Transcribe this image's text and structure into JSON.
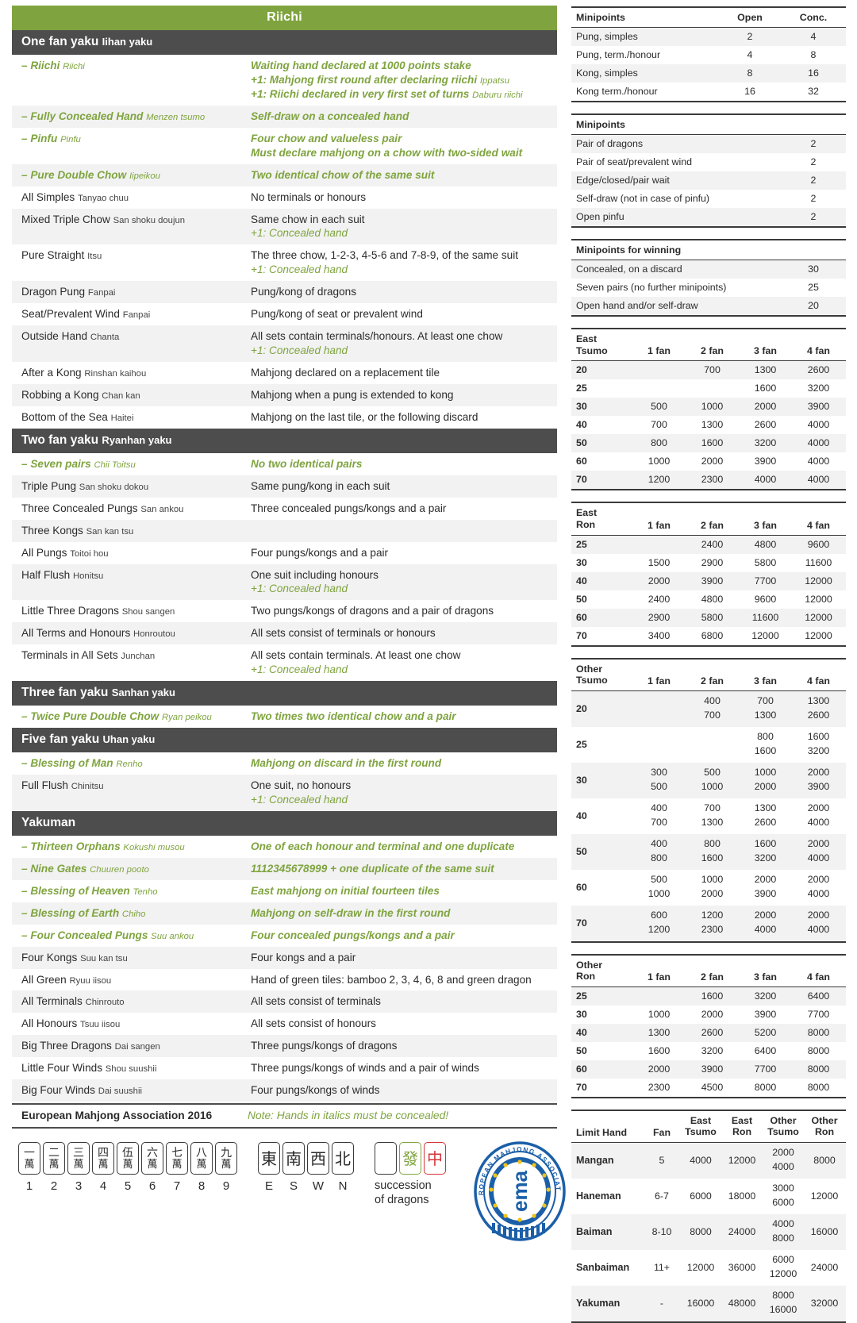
{
  "title": "Riichi",
  "sections": [
    {
      "heading": "One fan yaku",
      "heading_rom": "Iihan yaku",
      "rows": [
        {
          "name": "– Riichi",
          "rom": "Riichi",
          "green": true,
          "desc": [
            "Waiting hand declared at 1000 points stake"
          ],
          "extras": [
            {
              "text": "+1: Mahjong first round after declaring riichi ",
              "rom": "Ippatsu"
            },
            {
              "text": "+1: Riichi declared in very first set of turns ",
              "rom": "Daburu riichi"
            }
          ]
        },
        {
          "name": "– Fully Concealed Hand",
          "rom": "Menzen tsumo",
          "green": true,
          "desc": [
            "Self-draw on a concealed hand"
          ]
        },
        {
          "name": "– Pinfu",
          "rom": "Pinfu",
          "green": true,
          "desc": [
            "Four chow and valueless pair",
            "Must declare mahjong on a chow with two-sided wait"
          ]
        },
        {
          "name": "– Pure Double Chow",
          "rom": "Iipeikou",
          "green": true,
          "desc": [
            "Two identical chow of the same suit"
          ]
        },
        {
          "name": "All Simples",
          "rom": "Tanyao chuu",
          "green": false,
          "desc": [
            "No terminals or honours"
          ]
        },
        {
          "name": "Mixed Triple Chow",
          "rom": "San shoku doujun",
          "green": false,
          "desc": [
            "Same chow in each suit"
          ],
          "plus": "+1: Concealed hand"
        },
        {
          "name": "Pure Straight",
          "rom": "Itsu",
          "green": false,
          "desc": [
            "The three chow, 1-2-3, 4-5-6 and 7-8-9, of the same suit"
          ],
          "plus": "+1: Concealed hand"
        },
        {
          "name": "Dragon Pung",
          "rom": "Fanpai",
          "green": false,
          "desc": [
            "Pung/kong of dragons"
          ]
        },
        {
          "name": "Seat/Prevalent Wind",
          "rom": "Fanpai",
          "green": false,
          "desc": [
            "Pung/kong of seat or prevalent wind"
          ]
        },
        {
          "name": "Outside Hand",
          "rom": "Chanta",
          "green": false,
          "desc": [
            "All sets contain terminals/honours. At least one chow"
          ],
          "plus": "+1: Concealed hand"
        },
        {
          "name": "After a Kong",
          "rom": "Rinshan kaihou",
          "green": false,
          "desc": [
            "Mahjong declared on a replacement tile"
          ]
        },
        {
          "name": "Robbing a Kong",
          "rom": "Chan kan",
          "green": false,
          "desc": [
            "Mahjong when a pung is extended to kong"
          ]
        },
        {
          "name": "Bottom of the Sea",
          "rom": "Haitei",
          "green": false,
          "desc": [
            "Mahjong on the last tile, or the following discard"
          ]
        }
      ]
    },
    {
      "heading": "Two fan yaku",
      "heading_rom": "Ryanhan yaku",
      "rows": [
        {
          "name": "– Seven pairs",
          "rom": "Chii Toitsu",
          "green": true,
          "desc": [
            "No two identical pairs"
          ]
        },
        {
          "name": "Triple Pung",
          "rom": "San shoku dokou",
          "green": false,
          "desc": [
            "Same pung/kong in each suit"
          ]
        },
        {
          "name": "Three Concealed Pungs",
          "rom": "San ankou",
          "green": false,
          "desc": [
            "Three concealed pungs/kongs and a pair"
          ]
        },
        {
          "name": "Three Kongs",
          "rom": "San kan tsu",
          "green": false,
          "desc": [
            ""
          ]
        },
        {
          "name": "All Pungs",
          "rom": "Toitoi hou",
          "green": false,
          "desc": [
            "Four pungs/kongs and a pair"
          ]
        },
        {
          "name": "Half Flush",
          "rom": "Honitsu",
          "green": false,
          "desc": [
            "One suit including honours"
          ],
          "plus": "+1: Concealed hand"
        },
        {
          "name": "Little Three Dragons",
          "rom": "Shou sangen",
          "green": false,
          "desc": [
            "Two pungs/kongs of dragons and a pair of dragons"
          ]
        },
        {
          "name": "All Terms and Honours",
          "rom": "Honroutou",
          "green": false,
          "desc": [
            "All sets consist of terminals or honours"
          ]
        },
        {
          "name": "Terminals in All Sets",
          "rom": "Junchan",
          "green": false,
          "desc": [
            "All sets contain terminals. At least one chow"
          ],
          "plus": "+1: Concealed hand"
        }
      ]
    },
    {
      "heading": "Three fan yaku",
      "heading_rom": "Sanhan yaku",
      "rows": [
        {
          "name": "– Twice Pure Double Chow",
          "rom": "Ryan peikou",
          "green": true,
          "desc": [
            "Two times two identical chow and a pair"
          ]
        }
      ]
    },
    {
      "heading": "Five fan yaku",
      "heading_rom": "Uhan yaku",
      "rows": [
        {
          "name": "– Blessing of Man",
          "rom": "Renho",
          "green": true,
          "desc": [
            "Mahjong on discard in the first round"
          ]
        },
        {
          "name": "Full Flush",
          "rom": "Chinitsu",
          "green": false,
          "desc": [
            "One suit, no honours"
          ],
          "plus": "+1: Concealed hand"
        }
      ]
    },
    {
      "heading": "Yakuman",
      "heading_rom": "",
      "rows": [
        {
          "name": "– Thirteen Orphans",
          "rom": "Kokushi musou",
          "green": true,
          "desc": [
            "One of each honour and terminal and one duplicate"
          ]
        },
        {
          "name": "– Nine Gates",
          "rom": "Chuuren pooto",
          "green": true,
          "desc": [
            "1112345678999 + one duplicate of the same suit"
          ]
        },
        {
          "name": "– Blessing of Heaven",
          "rom": "Tenho",
          "green": true,
          "desc": [
            "East mahjong on initial fourteen tiles"
          ]
        },
        {
          "name": "– Blessing of Earth",
          "rom": "Chiho",
          "green": true,
          "desc": [
            "Mahjong on self-draw in the first round"
          ]
        },
        {
          "name": "– Four Concealed Pungs",
          "rom": "Suu ankou",
          "green": true,
          "desc": [
            "Four concealed pungs/kongs and a pair"
          ]
        },
        {
          "name": "Four Kongs",
          "rom": "Suu kan tsu",
          "green": false,
          "desc": [
            "Four kongs and a pair"
          ]
        },
        {
          "name": "All Green",
          "rom": "Ryuu iisou",
          "green": false,
          "desc": [
            "Hand of green tiles: bamboo 2, 3, 4, 6, 8 and green dragon"
          ]
        },
        {
          "name": "All Terminals",
          "rom": "Chinrouto",
          "green": false,
          "desc": [
            "All sets consist of terminals"
          ]
        },
        {
          "name": "All Honours",
          "rom": "Tsuu iisou",
          "green": false,
          "desc": [
            "All sets consist of honours"
          ]
        },
        {
          "name": "Big Three Dragons",
          "rom": "Dai sangen",
          "green": false,
          "desc": [
            "Three pungs/kongs of dragons"
          ]
        },
        {
          "name": "Little Four Winds",
          "rom": "Shou suushii",
          "green": false,
          "desc": [
            "Three pungs/kongs of winds and a pair of winds"
          ]
        },
        {
          "name": "Big Four Winds",
          "rom": "Dai suushii",
          "green": false,
          "desc": [
            "Four pungs/kongs of winds"
          ]
        }
      ]
    }
  ],
  "footer": {
    "ema": "European Mahjong Association 2016",
    "note": "Note: Hands in italics must be concealed!"
  },
  "tiles": {
    "characters": [
      {
        "top": "一",
        "bottom": "萬",
        "label": "1"
      },
      {
        "top": "二",
        "bottom": "萬",
        "label": "2"
      },
      {
        "top": "三",
        "bottom": "萬",
        "label": "3"
      },
      {
        "top": "四",
        "bottom": "萬",
        "label": "4"
      },
      {
        "top": "伍",
        "bottom": "萬",
        "label": "5"
      },
      {
        "top": "六",
        "bottom": "萬",
        "label": "6"
      },
      {
        "top": "七",
        "bottom": "萬",
        "label": "7"
      },
      {
        "top": "八",
        "bottom": "萬",
        "label": "8"
      },
      {
        "top": "九",
        "bottom": "萬",
        "label": "9"
      }
    ],
    "winds": [
      {
        "glyph": "東",
        "label": "E"
      },
      {
        "glyph": "南",
        "label": "S"
      },
      {
        "glyph": "西",
        "label": "W"
      },
      {
        "glyph": "北",
        "label": "N"
      }
    ],
    "dragons": [
      {
        "glyph": "",
        "color": "white"
      },
      {
        "glyph": "發",
        "color": "green"
      },
      {
        "glyph": "中",
        "color": "red"
      }
    ],
    "dragons_label_line1": "succession",
    "dragons_label_line2": "of dragons"
  },
  "logo": {
    "arc_top": "EUROPEAN MAHJONG ASSOCIATION",
    "center": "ema"
  },
  "colors": {
    "green": "#7fa43f",
    "dark": "#4d4d4d",
    "alt_row": "#f2f2f2",
    "red": "#d4343a"
  },
  "tables": {
    "minipoints_sets": {
      "title": "Minipoints",
      "columns": [
        "Open",
        "Conc."
      ],
      "rows": [
        {
          "label": "Pung, simples",
          "values": [
            "2",
            "4"
          ]
        },
        {
          "label": "Pung, term./honour",
          "values": [
            "4",
            "8"
          ]
        },
        {
          "label": "Kong, simples",
          "values": [
            "8",
            "16"
          ]
        },
        {
          "label": "Kong term./honour",
          "values": [
            "16",
            "32"
          ]
        }
      ]
    },
    "minipoints_misc": {
      "title": "Minipoints",
      "rows": [
        {
          "label": "Pair of dragons",
          "value": "2"
        },
        {
          "label": "Pair of seat/prevalent wind",
          "value": "2"
        },
        {
          "label": "Edge/closed/pair wait",
          "value": "2"
        },
        {
          "label": "Self-draw (not in case of pinfu)",
          "value": "2"
        },
        {
          "label": "Open pinfu",
          "value": "2"
        }
      ]
    },
    "minipoints_winning": {
      "title": "Minipoints for winning",
      "rows": [
        {
          "label": "Concealed, on a discard",
          "value": "30"
        },
        {
          "label": "Seven pairs (no further minipoints)",
          "value": "25"
        },
        {
          "label": "Open hand and/or self-draw",
          "value": "20"
        }
      ]
    },
    "east_tsumo": {
      "title_line1": "East",
      "title_line2": "Tsumo",
      "columns": [
        "1 fan",
        "2 fan",
        "3 fan",
        "4 fan"
      ],
      "rows": [
        {
          "fu": "20",
          "values": [
            "",
            "700",
            "1300",
            "2600"
          ]
        },
        {
          "fu": "25",
          "values": [
            "",
            "",
            "1600",
            "3200"
          ]
        },
        {
          "fu": "30",
          "values": [
            "500",
            "1000",
            "2000",
            "3900"
          ]
        },
        {
          "fu": "40",
          "values": [
            "700",
            "1300",
            "2600",
            "4000"
          ]
        },
        {
          "fu": "50",
          "values": [
            "800",
            "1600",
            "3200",
            "4000"
          ]
        },
        {
          "fu": "60",
          "values": [
            "1000",
            "2000",
            "3900",
            "4000"
          ]
        },
        {
          "fu": "70",
          "values": [
            "1200",
            "2300",
            "4000",
            "4000"
          ]
        }
      ]
    },
    "east_ron": {
      "title_line1": "East",
      "title_line2": "Ron",
      "columns": [
        "1 fan",
        "2 fan",
        "3 fan",
        "4 fan"
      ],
      "rows": [
        {
          "fu": "25",
          "values": [
            "",
            "2400",
            "4800",
            "9600"
          ]
        },
        {
          "fu": "30",
          "values": [
            "1500",
            "2900",
            "5800",
            "11600"
          ]
        },
        {
          "fu": "40",
          "values": [
            "2000",
            "3900",
            "7700",
            "12000"
          ]
        },
        {
          "fu": "50",
          "values": [
            "2400",
            "4800",
            "9600",
            "12000"
          ]
        },
        {
          "fu": "60",
          "values": [
            "2900",
            "5800",
            "11600",
            "12000"
          ]
        },
        {
          "fu": "70",
          "values": [
            "3400",
            "6800",
            "12000",
            "12000"
          ]
        }
      ]
    },
    "other_tsumo": {
      "title_line1": "Other",
      "title_line2": "Tsumo",
      "columns": [
        "1 fan",
        "2 fan",
        "3 fan",
        "4 fan"
      ],
      "rows": [
        {
          "fu": "20",
          "values": [
            [
              "",
              ""
            ],
            [
              "400",
              "700"
            ],
            [
              "700",
              "1300"
            ],
            [
              "1300",
              "2600"
            ]
          ]
        },
        {
          "fu": "25",
          "values": [
            [
              "",
              ""
            ],
            [
              "",
              ""
            ],
            [
              "800",
              "1600"
            ],
            [
              "1600",
              "3200"
            ]
          ]
        },
        {
          "fu": "30",
          "values": [
            [
              "300",
              "500"
            ],
            [
              "500",
              "1000"
            ],
            [
              "1000",
              "2000"
            ],
            [
              "2000",
              "3900"
            ]
          ]
        },
        {
          "fu": "40",
          "values": [
            [
              "400",
              "700"
            ],
            [
              "700",
              "1300"
            ],
            [
              "1300",
              "2600"
            ],
            [
              "2000",
              "4000"
            ]
          ]
        },
        {
          "fu": "50",
          "values": [
            [
              "400",
              "800"
            ],
            [
              "800",
              "1600"
            ],
            [
              "1600",
              "3200"
            ],
            [
              "2000",
              "4000"
            ]
          ]
        },
        {
          "fu": "60",
          "values": [
            [
              "500",
              "1000"
            ],
            [
              "1000",
              "2000"
            ],
            [
              "2000",
              "3900"
            ],
            [
              "2000",
              "4000"
            ]
          ]
        },
        {
          "fu": "70",
          "values": [
            [
              "600",
              "1200"
            ],
            [
              "1200",
              "2300"
            ],
            [
              "2000",
              "4000"
            ],
            [
              "2000",
              "4000"
            ]
          ]
        }
      ]
    },
    "other_ron": {
      "title_line1": "Other",
      "title_line2": "Ron",
      "columns": [
        "1 fan",
        "2 fan",
        "3 fan",
        "4 fan"
      ],
      "rows": [
        {
          "fu": "25",
          "values": [
            "",
            "1600",
            "3200",
            "6400"
          ]
        },
        {
          "fu": "30",
          "values": [
            "1000",
            "2000",
            "3900",
            "7700"
          ]
        },
        {
          "fu": "40",
          "values": [
            "1300",
            "2600",
            "5200",
            "8000"
          ]
        },
        {
          "fu": "50",
          "values": [
            "1600",
            "3200",
            "6400",
            "8000"
          ]
        },
        {
          "fu": "60",
          "values": [
            "2000",
            "3900",
            "7700",
            "8000"
          ]
        },
        {
          "fu": "70",
          "values": [
            "2300",
            "4500",
            "8000",
            "8000"
          ]
        }
      ]
    },
    "limit_hands": {
      "col_name": "Limit Hand",
      "col_fan": "Fan",
      "columns": [
        {
          "l1": "East",
          "l2": "Tsumo"
        },
        {
          "l1": "East",
          "l2": "Ron"
        },
        {
          "l1": "Other",
          "l2": "Tsumo"
        },
        {
          "l1": "Other",
          "l2": "Ron"
        }
      ],
      "rows": [
        {
          "name": "Mangan",
          "fan": "5",
          "east_tsumo": "4000",
          "east_ron": "12000",
          "other_tsumo": [
            "2000",
            "4000"
          ],
          "other_ron": "8000"
        },
        {
          "name": "Haneman",
          "fan": "6-7",
          "east_tsumo": "6000",
          "east_ron": "18000",
          "other_tsumo": [
            "3000",
            "6000"
          ],
          "other_ron": "12000"
        },
        {
          "name": "Baiman",
          "fan": "8-10",
          "east_tsumo": "8000",
          "east_ron": "24000",
          "other_tsumo": [
            "4000",
            "8000"
          ],
          "other_ron": "16000"
        },
        {
          "name": "Sanbaiman",
          "fan": "11+",
          "east_tsumo": "12000",
          "east_ron": "36000",
          "other_tsumo": [
            "6000",
            "12000"
          ],
          "other_ron": "24000"
        },
        {
          "name": "Yakuman",
          "fan": "-",
          "east_tsumo": "16000",
          "east_ron": "48000",
          "other_tsumo": [
            "8000",
            "16000"
          ],
          "other_ron": "32000"
        }
      ]
    }
  }
}
